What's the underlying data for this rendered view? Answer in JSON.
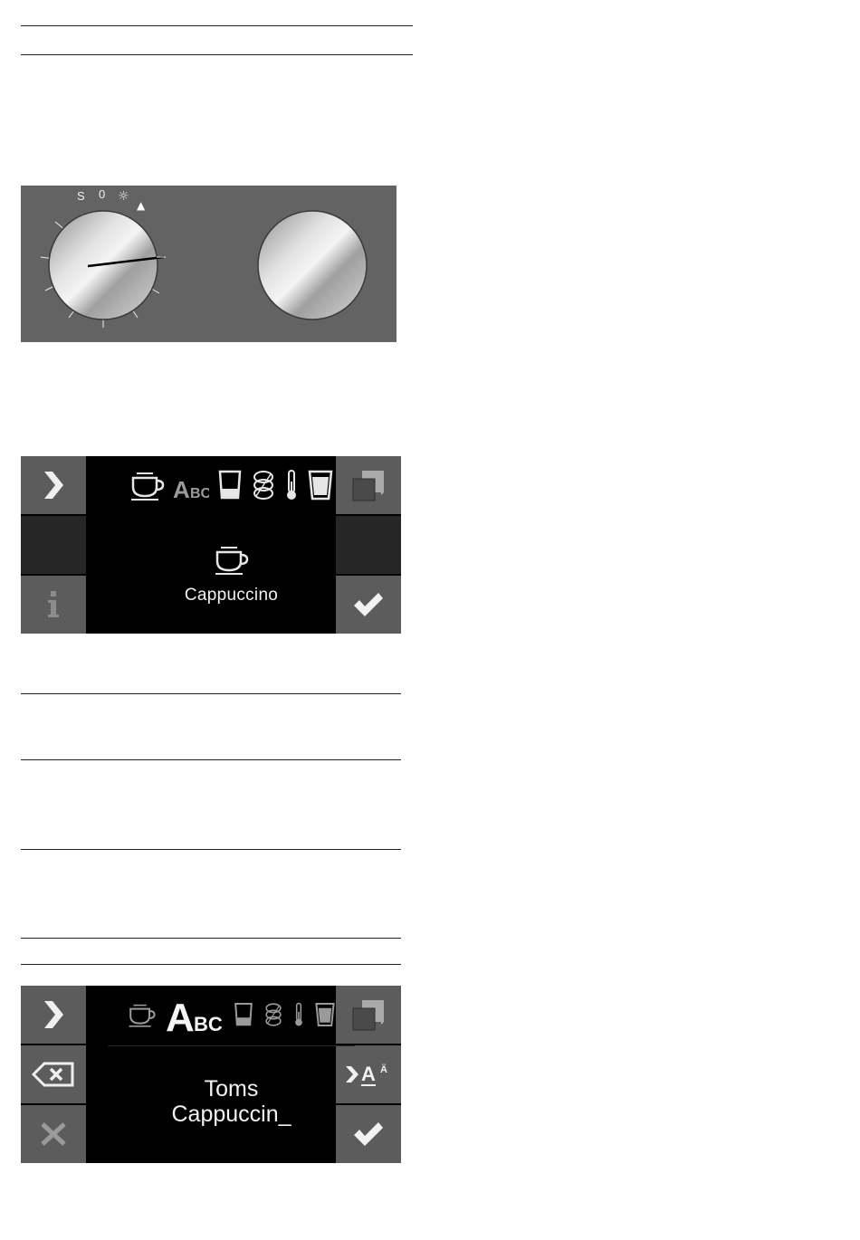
{
  "knob_panel": {
    "left_knob_labels": [
      "S",
      "0",
      "☼",
      "▲"
    ],
    "colors": {
      "panel": "#636363",
      "knob_face": "#c8c8c8",
      "pointer": "#000000"
    }
  },
  "display1": {
    "top_icons": [
      "cup-icon",
      "abc-icon",
      "glass-icon",
      "beans-icon",
      "thermometer-icon",
      "tall-glass-icon"
    ],
    "active_icon": "none",
    "drink_icon": "cup-icon",
    "drink_label": "Cappuccino",
    "left_buttons": [
      "chevron-right-icon",
      "blank",
      "info-icon"
    ],
    "right_buttons": [
      "copy-icon",
      "blank",
      "checkmark-icon"
    ]
  },
  "display2": {
    "top_icons": [
      "cup-icon",
      "abc-icon",
      "glass-icon",
      "beans-icon",
      "thermometer-icon",
      "tall-glass-icon"
    ],
    "active_icon": "abc-icon",
    "name_text": "Toms\nCappuccin_",
    "left_buttons": [
      "chevron-right-icon",
      "backspace-icon",
      "close-icon"
    ],
    "right_buttons": [
      "copy-icon",
      "case-switch-icon",
      "checkmark-icon"
    ],
    "case_switch_text": {
      "big": "A",
      "small": "Ä"
    }
  }
}
